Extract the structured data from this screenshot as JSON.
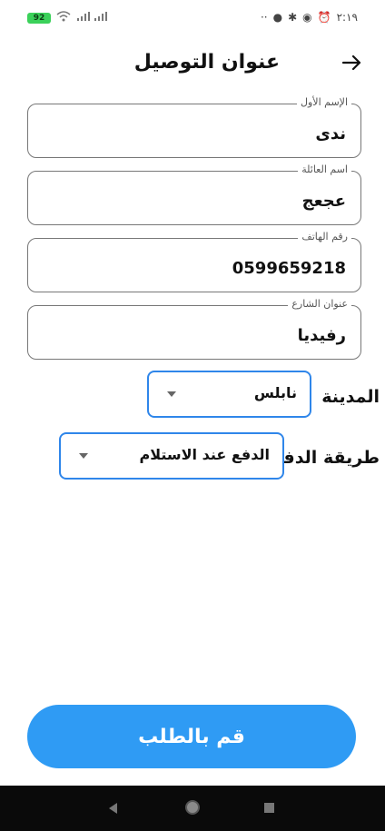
{
  "status_bar": {
    "battery": "92",
    "time": "٢:١٩"
  },
  "header": {
    "title": "عنوان التوصيل"
  },
  "form": {
    "first_name": {
      "label": "الإسم الأول",
      "value": "ندى"
    },
    "last_name": {
      "label": "اسم العائلة",
      "value": "عجعج"
    },
    "phone": {
      "label": "رقم الهاتف",
      "value": "0599659218"
    },
    "street": {
      "label": "عنوان الشارع",
      "value": "رفيديا"
    },
    "city": {
      "label": "المدينة",
      "selected": "نابلس"
    },
    "payment": {
      "label": "طريقة الدفع",
      "selected": "الدفع عند الاستلام"
    }
  },
  "submit": {
    "label": "قم بالطلب"
  },
  "colors": {
    "accent": "#2f9bf4",
    "dropdown_border": "#2f86ea"
  }
}
